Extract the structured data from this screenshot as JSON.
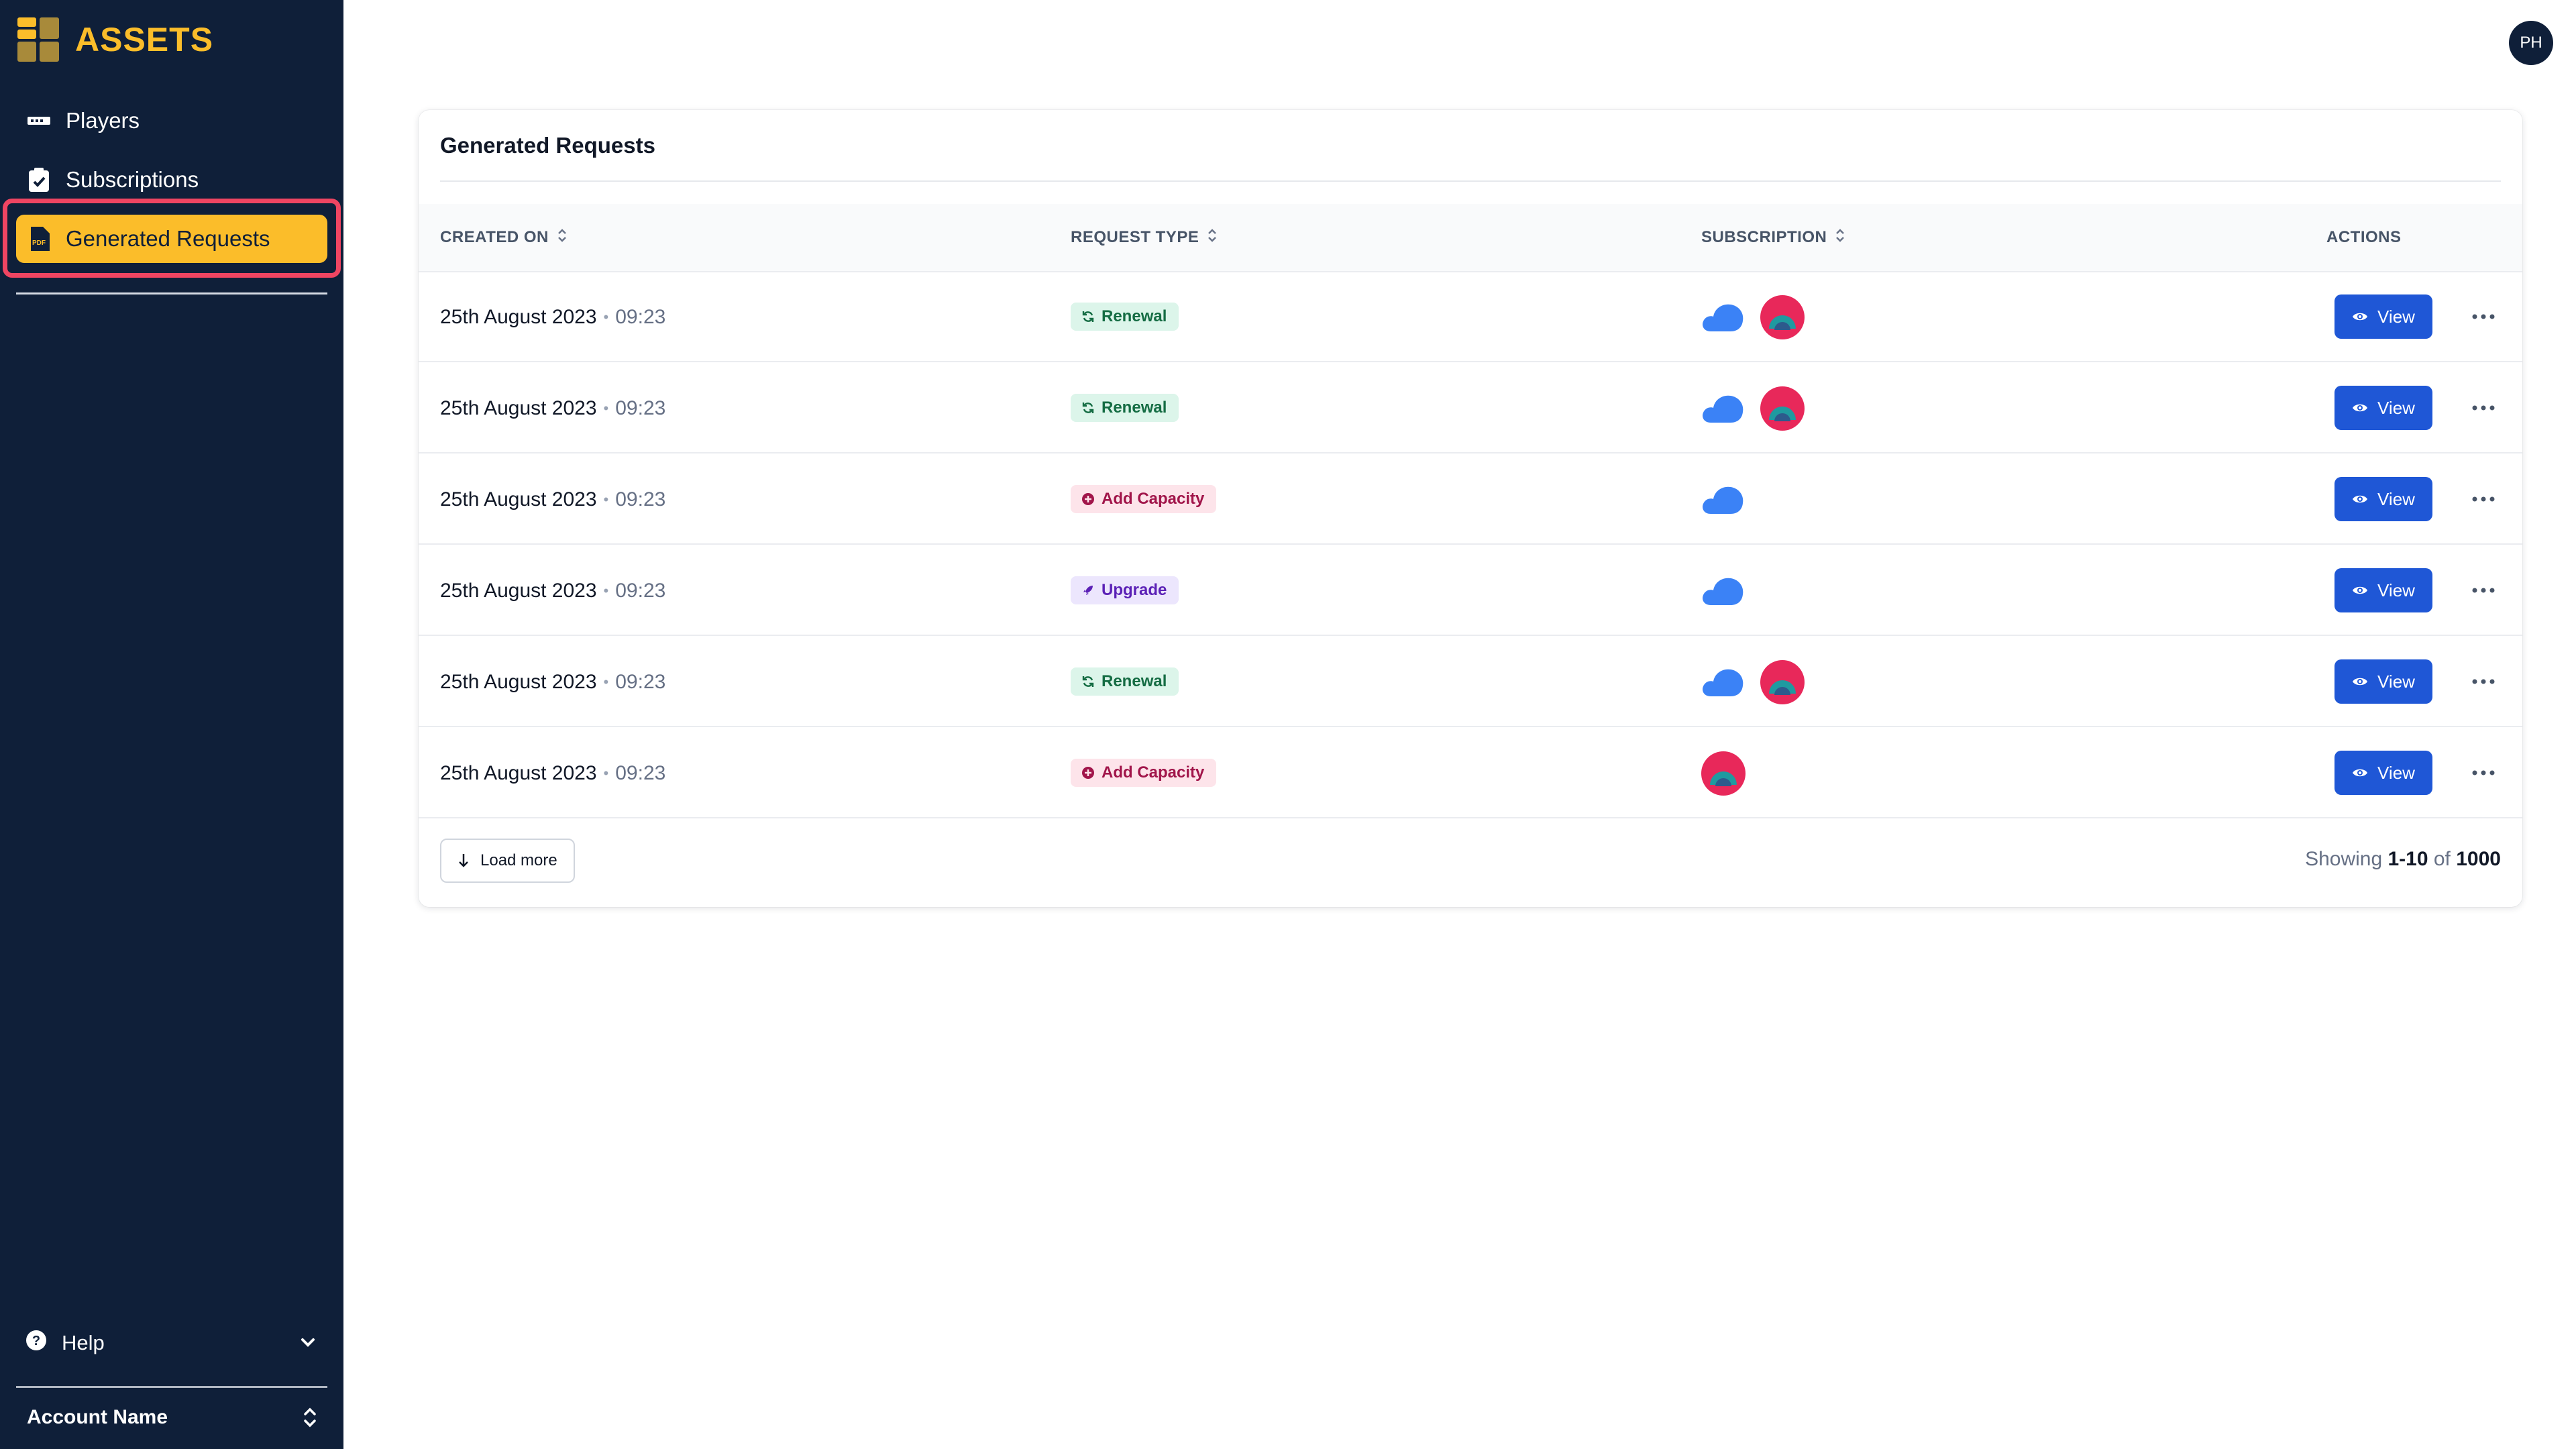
{
  "sidebar": {
    "brand": "ASSETS",
    "items": [
      {
        "label": "Players",
        "icon": "ticket-icon"
      },
      {
        "label": "Subscriptions",
        "icon": "clipboard-check-icon"
      },
      {
        "label": "Generated Requests",
        "icon": "pdf-file-icon",
        "active": true
      }
    ],
    "help_label": "Help",
    "account_label": "Account Name"
  },
  "header": {
    "avatar_initials": "PH"
  },
  "card": {
    "title": "Generated Requests",
    "columns": {
      "created_on": "CREATED ON",
      "request_type": "REQUEST TYPE",
      "subscription": "SUBSCRIPTION",
      "actions": "ACTIONS"
    },
    "rows": [
      {
        "date": "25th August 2023",
        "time": "09:23",
        "type": "Renewal",
        "kind": "renewal",
        "subs": [
          "cloud",
          "rainbow"
        ],
        "action": "View"
      },
      {
        "date": "25th August 2023",
        "time": "09:23",
        "type": "Renewal",
        "kind": "renewal",
        "subs": [
          "cloud",
          "rainbow"
        ],
        "action": "View"
      },
      {
        "date": "25th August 2023",
        "time": "09:23",
        "type": "Add Capacity",
        "kind": "capacity",
        "subs": [
          "cloud"
        ],
        "action": "View"
      },
      {
        "date": "25th August 2023",
        "time": "09:23",
        "type": "Upgrade",
        "kind": "upgrade",
        "subs": [
          "cloud"
        ],
        "action": "View"
      },
      {
        "date": "25th August 2023",
        "time": "09:23",
        "type": "Renewal",
        "kind": "renewal",
        "subs": [
          "cloud",
          "rainbow"
        ],
        "action": "View"
      },
      {
        "date": "25th August 2023",
        "time": "09:23",
        "type": "Add Capacity",
        "kind": "capacity",
        "subs": [
          "rainbow"
        ],
        "action": "View"
      }
    ],
    "footer": {
      "load_more": "Load more",
      "showing_prefix": "Showing",
      "showing_range": "1-10",
      "showing_of": "of",
      "showing_total": "1000"
    }
  },
  "colors": {
    "sidebar_bg": "#0f1f39",
    "accent": "#fbbd2a",
    "active_outline": "#ef4562",
    "primary_button": "#1f57d6",
    "renewal_badge": "#dcf5ea",
    "capacity_badge": "#fde4ea",
    "upgrade_badge": "#ece6fd",
    "cloud_icon": "#3b82f6",
    "rainbow_icon": "#e8285a"
  }
}
